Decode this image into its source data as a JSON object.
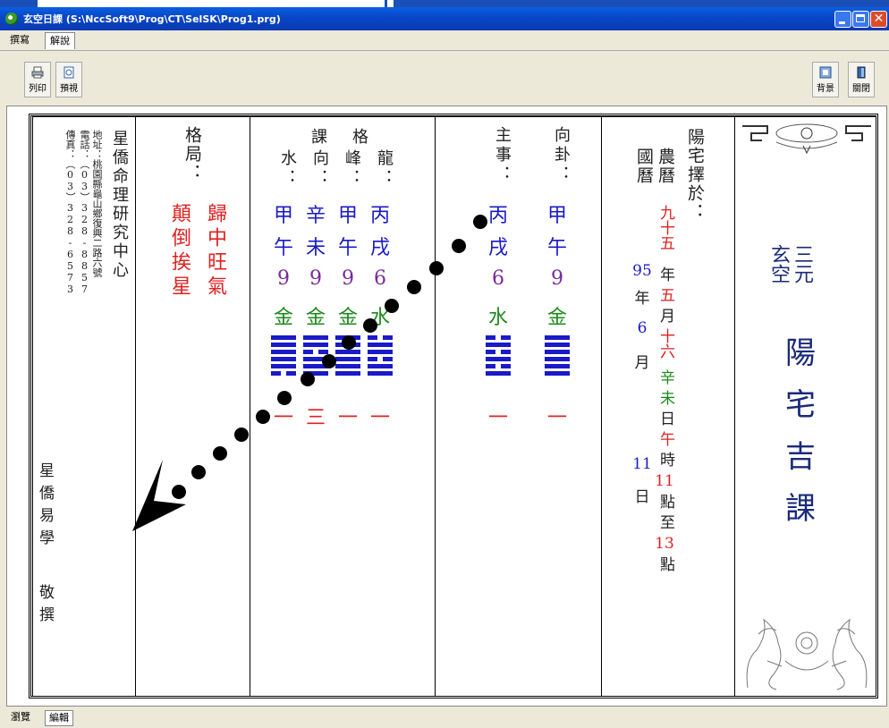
{
  "window": {
    "title": "玄空日課 (S:\\NccSoft9\\Prog\\CT\\SelSK\\Prog1.prg)",
    "colors": {
      "titlebar": "#0a4fd8",
      "close": "#e04a28"
    }
  },
  "menu": {
    "tabs": [
      "撰寫",
      "解說"
    ],
    "active": "解說"
  },
  "toolbar": {
    "print_label": "列印",
    "preview_label": "預視",
    "background_label": "背景",
    "close_label": "關閉"
  },
  "doc": {
    "company": {
      "name": "星僑命理研究中心",
      "address": "地址：桃園縣龜山鄉復興二路六號",
      "phone": "電話：（03）328-8857",
      "fax": "傳真：（03）328-6573",
      "sign_name": "星僑易學",
      "sign_action": "敬撰"
    },
    "geju": {
      "header": "格局：",
      "col1": "歸中旺氣",
      "col2": "顛倒挨星"
    },
    "kege": {
      "header": "課格",
      "items": [
        {
          "label": "龍：",
          "stem": "丙",
          "branch": "戌",
          "num": "6",
          "element": "水",
          "trigram": [
            0,
            1,
            1,
            0,
            1,
            1
          ],
          "sub": "一"
        },
        {
          "label": "峰：",
          "stem": "甲",
          "branch": "午",
          "num": "9",
          "element": "金",
          "trigram": [
            1,
            1,
            1,
            1,
            1,
            1
          ],
          "sub": "一"
        },
        {
          "label": "向：",
          "stem": "辛",
          "branch": "未",
          "num": "9",
          "element": "金",
          "trigram": [
            1,
            1,
            0,
            1,
            1,
            1
          ],
          "sub": "三"
        },
        {
          "label": "水：",
          "stem": "甲",
          "branch": "午",
          "num": "9",
          "element": "金",
          "trigram": [
            1,
            1,
            1,
            1,
            1,
            0
          ],
          "sub": "一"
        }
      ]
    },
    "zhushi": {
      "header": "主事：",
      "stem": "丙",
      "branch": "戌",
      "num": "6",
      "element": "水",
      "trigram": [
        0,
        1,
        0,
        1,
        0,
        1
      ],
      "sub": "一"
    },
    "xianggua": {
      "header": "向卦：",
      "stem": "甲",
      "branch": "午",
      "num": "9",
      "element": "金",
      "trigram": [
        1,
        1,
        1,
        1,
        1,
        1
      ],
      "sub": "一"
    },
    "date": {
      "header": "陽宅擇於：",
      "lunar_label": "農曆",
      "solar_label": "國曆",
      "lunar_year": "九十五",
      "year_unit": "年",
      "lunar_month": "五",
      "month_unit": "月",
      "lunar_day": "十六",
      "day_ganzhi_gan": "辛",
      "day_ganzhi_zhi": "未",
      "day_unit": "日",
      "hour_zhi": "午",
      "hour_unit": "時",
      "hour_from": "11",
      "point": "點",
      "to": "至",
      "hour_to": "13",
      "solar_year": "95",
      "solar_month": "6",
      "solar_day": "11"
    },
    "title_block": {
      "line1": "三元",
      "line2": "玄空",
      "main": [
        "陽",
        "宅",
        "吉",
        "課"
      ]
    }
  },
  "bottom": {
    "tabs": [
      "瀏覽",
      "編輯"
    ],
    "active": "編輯"
  }
}
